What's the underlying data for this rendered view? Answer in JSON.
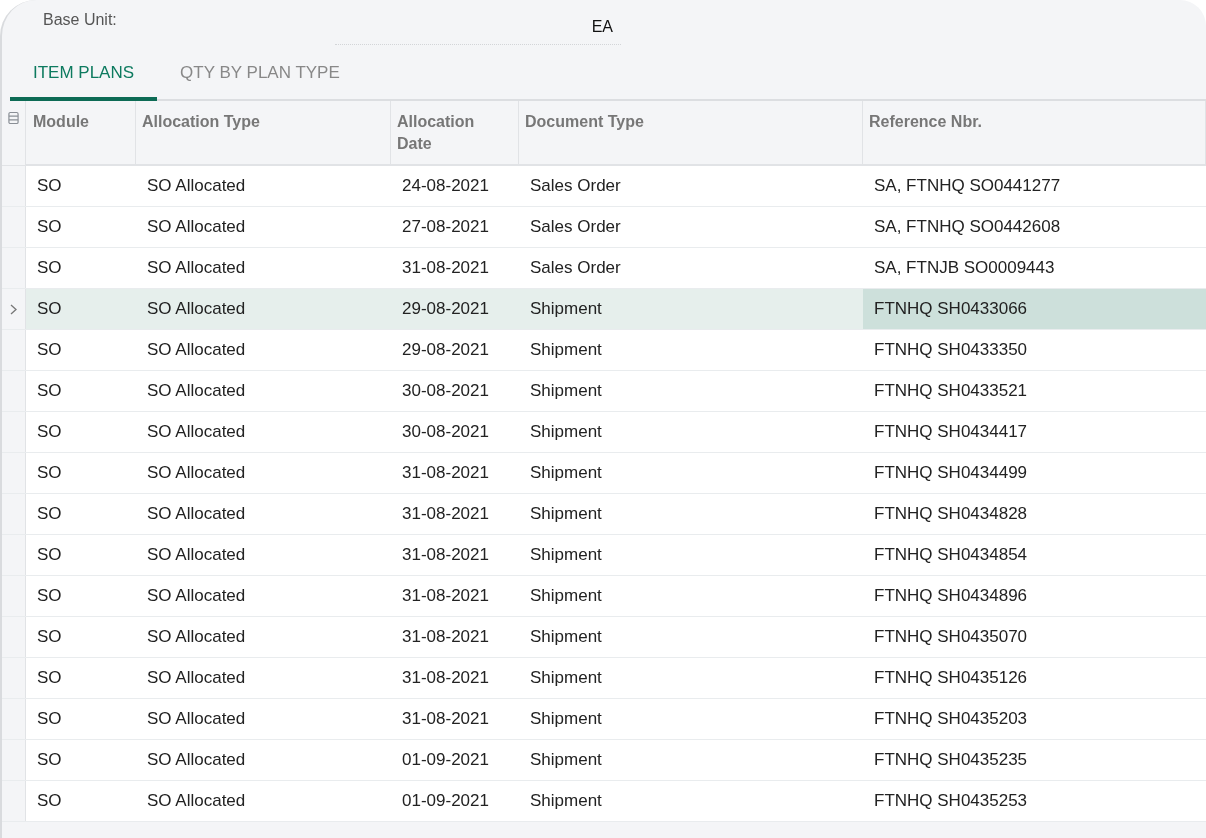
{
  "form": {
    "label": "Base Unit:",
    "value": "EA"
  },
  "tabs": [
    {
      "label": "ITEM PLANS",
      "selected": true
    },
    {
      "label": "QTY BY PLAN TYPE",
      "selected": false
    }
  ],
  "table": {
    "columns": [
      "Module",
      "Allocation Type",
      "Allocation Date",
      "Document Type",
      "Reference Nbr."
    ],
    "rows": [
      {
        "selected": false,
        "cells": [
          "SO",
          "SO Allocated",
          "24-08-2021",
          "Sales Order",
          "SA, FTNHQ SO0441277"
        ]
      },
      {
        "selected": false,
        "cells": [
          "SO",
          "SO Allocated",
          "27-08-2021",
          "Sales Order",
          "SA, FTNHQ SO0442608"
        ]
      },
      {
        "selected": false,
        "cells": [
          "SO",
          "SO Allocated",
          "31-08-2021",
          "Sales Order",
          "SA, FTNJB SO0009443"
        ]
      },
      {
        "selected": true,
        "cells": [
          "SO",
          "SO Allocated",
          "29-08-2021",
          "Shipment",
          "FTNHQ SH0433066"
        ]
      },
      {
        "selected": false,
        "cells": [
          "SO",
          "SO Allocated",
          "29-08-2021",
          "Shipment",
          "FTNHQ SH0433350"
        ]
      },
      {
        "selected": false,
        "cells": [
          "SO",
          "SO Allocated",
          "30-08-2021",
          "Shipment",
          "FTNHQ SH0433521"
        ]
      },
      {
        "selected": false,
        "cells": [
          "SO",
          "SO Allocated",
          "30-08-2021",
          "Shipment",
          "FTNHQ SH0434417"
        ]
      },
      {
        "selected": false,
        "cells": [
          "SO",
          "SO Allocated",
          "31-08-2021",
          "Shipment",
          "FTNHQ SH0434499"
        ]
      },
      {
        "selected": false,
        "cells": [
          "SO",
          "SO Allocated",
          "31-08-2021",
          "Shipment",
          "FTNHQ SH0434828"
        ]
      },
      {
        "selected": false,
        "cells": [
          "SO",
          "SO Allocated",
          "31-08-2021",
          "Shipment",
          "FTNHQ SH0434854"
        ]
      },
      {
        "selected": false,
        "cells": [
          "SO",
          "SO Allocated",
          "31-08-2021",
          "Shipment",
          "FTNHQ SH0434896"
        ]
      },
      {
        "selected": false,
        "cells": [
          "SO",
          "SO Allocated",
          "31-08-2021",
          "Shipment",
          "FTNHQ SH0435070"
        ]
      },
      {
        "selected": false,
        "cells": [
          "SO",
          "SO Allocated",
          "31-08-2021",
          "Shipment",
          "FTNHQ SH0435126"
        ]
      },
      {
        "selected": false,
        "cells": [
          "SO",
          "SO Allocated",
          "31-08-2021",
          "Shipment",
          "FTNHQ SH0435203"
        ]
      },
      {
        "selected": false,
        "cells": [
          "SO",
          "SO Allocated",
          "01-09-2021",
          "Shipment",
          "FTNHQ SH0435235"
        ]
      },
      {
        "selected": false,
        "cells": [
          "SO",
          "SO Allocated",
          "01-09-2021",
          "Shipment",
          "FTNHQ SH0435253"
        ]
      }
    ]
  }
}
